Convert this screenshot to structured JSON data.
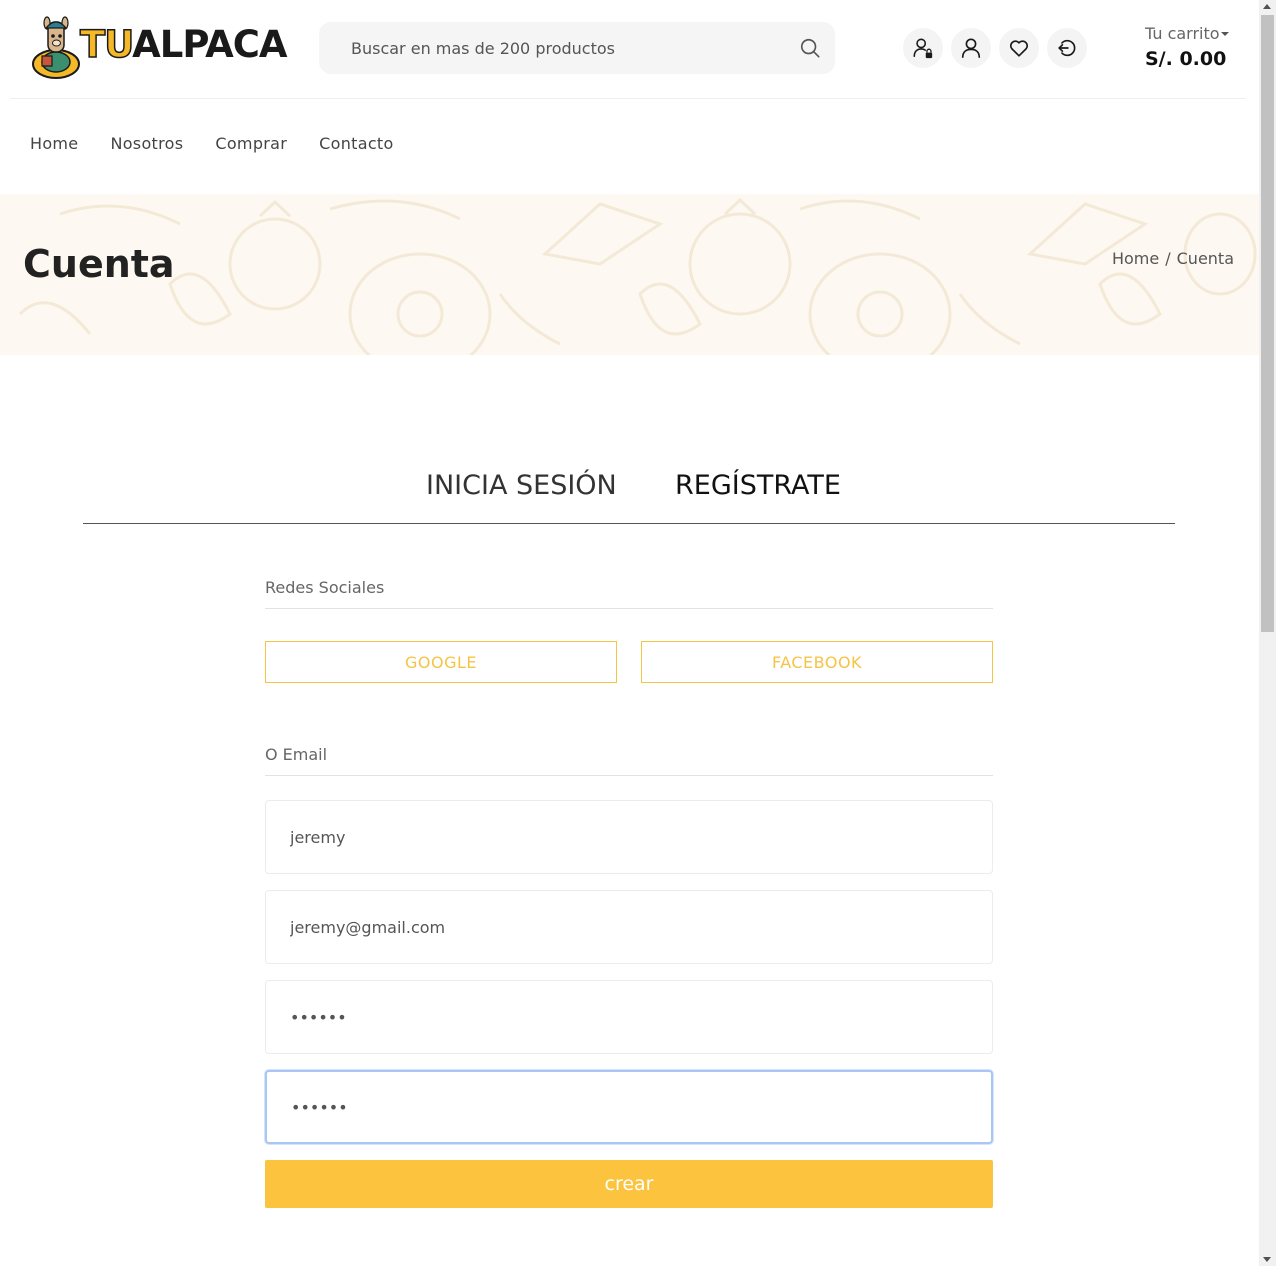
{
  "brand": {
    "logo_tu": "TU",
    "logo_alpaca": "ALPACA",
    "colors": {
      "accent": "#fcc33f",
      "accent_outline": "#f5c445",
      "text": "#222222"
    }
  },
  "header": {
    "search_placeholder": "Buscar en mas de 200 productos",
    "icons": [
      "user-lock-icon",
      "user-icon",
      "heart-icon",
      "logout-icon"
    ],
    "cart_label": "Tu carrito",
    "cart_total": "S/. 0.00"
  },
  "nav": {
    "items": [
      {
        "label": "Home"
      },
      {
        "label": "Nosotros"
      },
      {
        "label": "Comprar"
      },
      {
        "label": "Contacto"
      }
    ]
  },
  "banner": {
    "title": "Cuenta",
    "breadcrumb": {
      "home": "Home",
      "separator": "/",
      "current": "Cuenta"
    }
  },
  "tabs": {
    "login": "INICIA SESIÓN",
    "register": "REGÍSTRATE",
    "active": "register"
  },
  "form": {
    "social_title": "Redes Sociales",
    "google_label": "GOOGLE",
    "facebook_label": "FACEBOOK",
    "email_title": "O Email",
    "username_value": "jeremy",
    "email_value": "jeremy@gmail.com",
    "password_value": "••••••",
    "confirm_password_value": "••••••",
    "submit_label": "crear"
  }
}
